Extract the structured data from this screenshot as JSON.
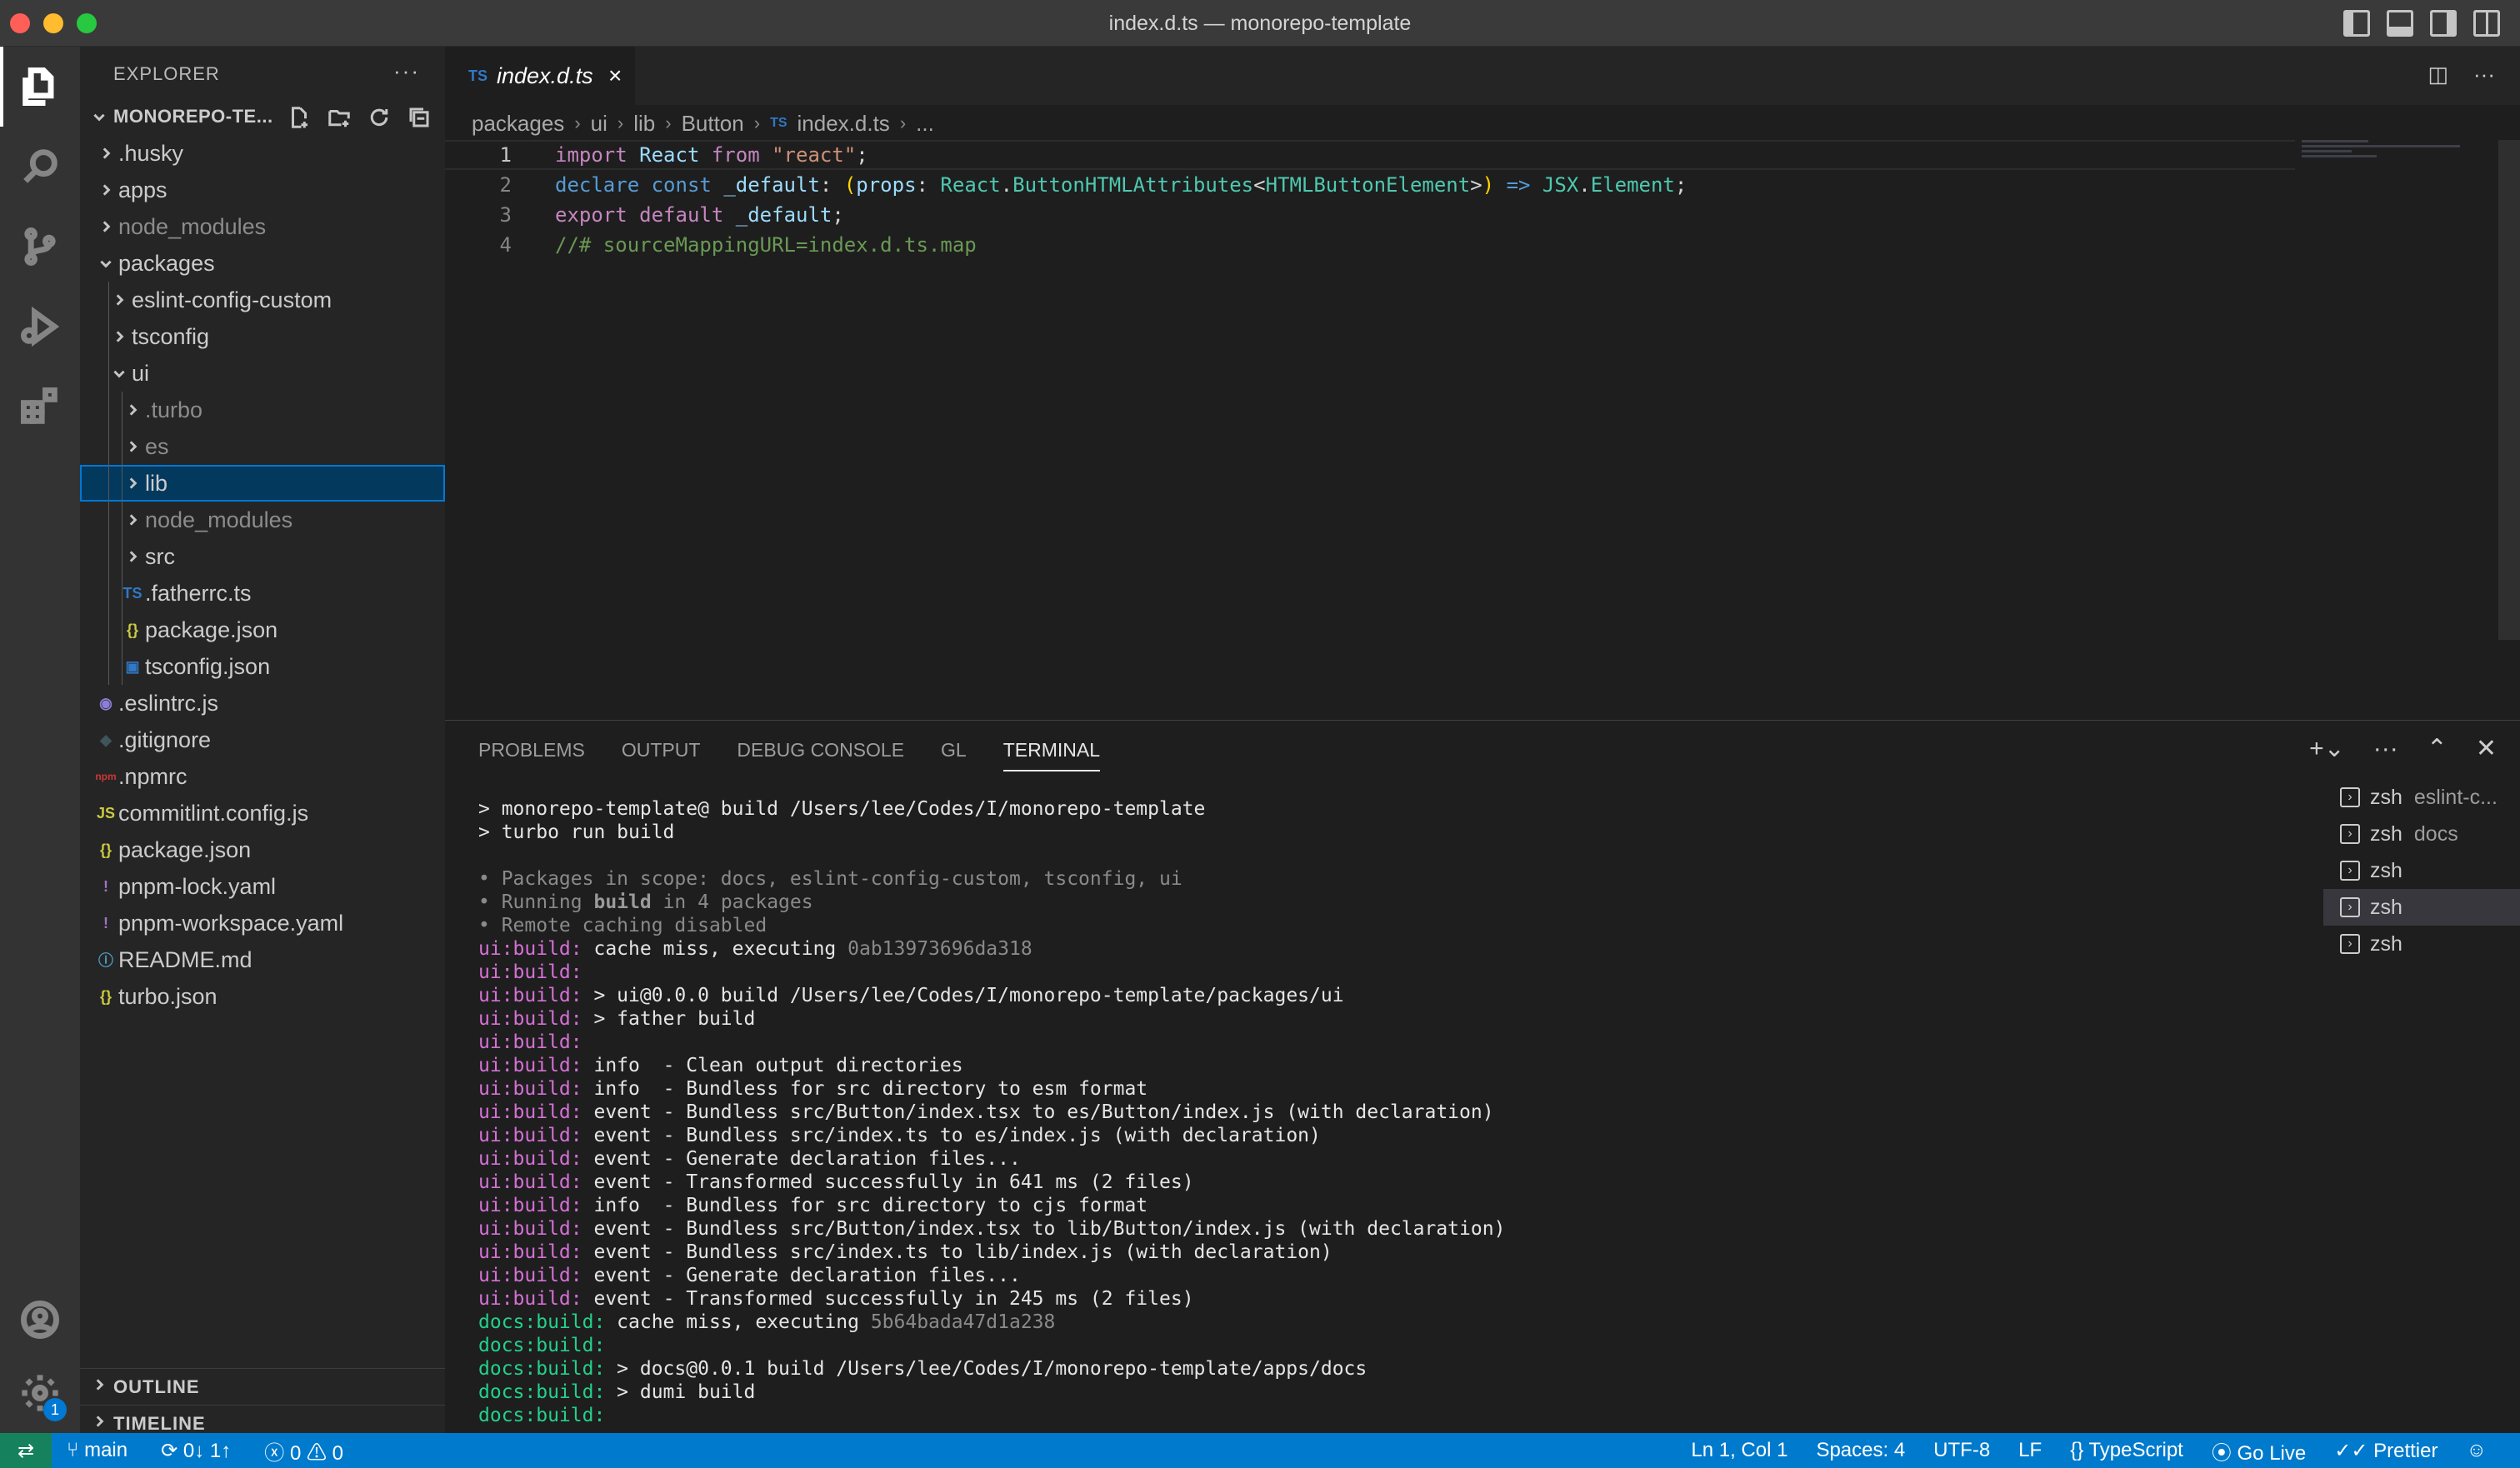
{
  "window": {
    "title": "index.d.ts — monorepo-template"
  },
  "sidebar": {
    "header": "EXPLORER",
    "root_label": "MONOREPO-TE...",
    "tree": [
      {
        "label": ".husky",
        "depth": 0,
        "type": "folder",
        "open": false,
        "dim": false
      },
      {
        "label": "apps",
        "depth": 0,
        "type": "folder",
        "open": false,
        "dim": false
      },
      {
        "label": "node_modules",
        "depth": 0,
        "type": "folder",
        "open": false,
        "dim": true
      },
      {
        "label": "packages",
        "depth": 0,
        "type": "folder",
        "open": true,
        "dim": false
      },
      {
        "label": "eslint-config-custom",
        "depth": 1,
        "type": "folder",
        "open": false,
        "dim": false
      },
      {
        "label": "tsconfig",
        "depth": 1,
        "type": "folder",
        "open": false,
        "dim": false
      },
      {
        "label": "ui",
        "depth": 1,
        "type": "folder",
        "open": true,
        "dim": false
      },
      {
        "label": ".turbo",
        "depth": 2,
        "type": "folder",
        "open": false,
        "dim": true
      },
      {
        "label": "es",
        "depth": 2,
        "type": "folder",
        "open": false,
        "dim": true
      },
      {
        "label": "lib",
        "depth": 2,
        "type": "folder",
        "open": false,
        "dim": false,
        "selected": true
      },
      {
        "label": "node_modules",
        "depth": 2,
        "type": "folder",
        "open": false,
        "dim": true
      },
      {
        "label": "src",
        "depth": 2,
        "type": "folder",
        "open": false,
        "dim": false
      },
      {
        "label": ".fatherrc.ts",
        "depth": 2,
        "type": "file",
        "icon": "ts",
        "dim": false
      },
      {
        "label": "package.json",
        "depth": 2,
        "type": "file",
        "icon": "json",
        "dim": false
      },
      {
        "label": "tsconfig.json",
        "depth": 2,
        "type": "file",
        "icon": "tsconfig",
        "dim": false
      },
      {
        "label": ".eslintrc.js",
        "depth": 0,
        "type": "file",
        "icon": "eslint",
        "dim": false
      },
      {
        "label": ".gitignore",
        "depth": 0,
        "type": "file",
        "icon": "git",
        "dim": false
      },
      {
        "label": ".npmrc",
        "depth": 0,
        "type": "file",
        "icon": "npm",
        "dim": false
      },
      {
        "label": "commitlint.config.js",
        "depth": 0,
        "type": "file",
        "icon": "js",
        "dim": false
      },
      {
        "label": "package.json",
        "depth": 0,
        "type": "file",
        "icon": "json",
        "dim": false
      },
      {
        "label": "pnpm-lock.yaml",
        "depth": 0,
        "type": "file",
        "icon": "yaml",
        "dim": false
      },
      {
        "label": "pnpm-workspace.yaml",
        "depth": 0,
        "type": "file",
        "icon": "yaml",
        "dim": false
      },
      {
        "label": "README.md",
        "depth": 0,
        "type": "file",
        "icon": "info",
        "dim": false
      },
      {
        "label": "turbo.json",
        "depth": 0,
        "type": "file",
        "icon": "json",
        "dim": false
      }
    ],
    "outline_label": "OUTLINE",
    "timeline_label": "TIMELINE"
  },
  "icons": {
    "ts": {
      "glyph": "TS",
      "color": "#3178c6"
    },
    "json": {
      "glyph": "{}",
      "color": "#cbcb41"
    },
    "tsconfig": {
      "glyph": "▣",
      "color": "#3178c6"
    },
    "eslint": {
      "glyph": "◉",
      "color": "#8b7fd8"
    },
    "git": {
      "glyph": "◆",
      "color": "#41535b"
    },
    "npm": {
      "glyph": "npm",
      "color": "#cb3837"
    },
    "js": {
      "glyph": "JS",
      "color": "#cbcb41"
    },
    "yaml": {
      "glyph": "!",
      "color": "#a074c4"
    },
    "info": {
      "glyph": "ⓘ",
      "color": "#519aba"
    }
  },
  "editor": {
    "tab": {
      "badge": "TS",
      "name": "index.d.ts",
      "close": "×"
    },
    "breadcrumbs": [
      "packages",
      "ui",
      "lib",
      "Button",
      "index.d.ts",
      "..."
    ],
    "lines": [
      {
        "n": "1",
        "tokens": [
          [
            "kw2",
            "import"
          ],
          [
            "pu",
            " "
          ],
          [
            "va",
            "React"
          ],
          [
            "pu",
            " "
          ],
          [
            "kw2",
            "from"
          ],
          [
            "pu",
            " "
          ],
          [
            "st",
            "\"react\""
          ],
          [
            "pu",
            ";"
          ]
        ]
      },
      {
        "n": "2",
        "tokens": [
          [
            "kw",
            "declare"
          ],
          [
            "pu",
            " "
          ],
          [
            "kw",
            "const"
          ],
          [
            "pu",
            " "
          ],
          [
            "va",
            "_default"
          ],
          [
            "pu",
            ": "
          ],
          [
            "br",
            "("
          ],
          [
            "va",
            "props"
          ],
          [
            "pu",
            ": "
          ],
          [
            "ty",
            "React"
          ],
          [
            "pu",
            "."
          ],
          [
            "ty",
            "ButtonHTMLAttributes"
          ],
          [
            "pu",
            "<"
          ],
          [
            "ty",
            "HTMLButtonElement"
          ],
          [
            "pu",
            ">"
          ],
          [
            "br",
            ")"
          ],
          [
            "pu",
            " "
          ],
          [
            "kw",
            "=>"
          ],
          [
            "pu",
            " "
          ],
          [
            "ty",
            "JSX"
          ],
          [
            "pu",
            "."
          ],
          [
            "ty",
            "Element"
          ],
          [
            "pu",
            ";"
          ]
        ]
      },
      {
        "n": "3",
        "tokens": [
          [
            "kw2",
            "export"
          ],
          [
            "pu",
            " "
          ],
          [
            "kw2",
            "default"
          ],
          [
            "pu",
            " "
          ],
          [
            "va",
            "_default"
          ],
          [
            "pu",
            ";"
          ]
        ]
      },
      {
        "n": "4",
        "tokens": [
          [
            "cm",
            "//# sourceMappingURL=index.d.ts.map"
          ]
        ]
      }
    ]
  },
  "panel": {
    "tabs": [
      "PROBLEMS",
      "OUTPUT",
      "DEBUG CONSOLE",
      "GL",
      "TERMINAL"
    ],
    "active_tab": "TERMINAL",
    "terminal_lines": [
      [
        [
          "",
          "> monorepo-template@ build /Users/lee/Codes/I/monorepo-template"
        ]
      ],
      [
        [
          "",
          "> turbo run build"
        ]
      ],
      [
        [
          "",
          ""
        ]
      ],
      [
        [
          "gr",
          "• Packages in scope: docs, eslint-config-custom, tsconfig, ui"
        ]
      ],
      [
        [
          "gr",
          "• Running "
        ],
        [
          "bd",
          "build"
        ],
        [
          "gr",
          " in 4 packages"
        ]
      ],
      [
        [
          "gr",
          "• Remote caching disabled"
        ]
      ],
      [
        [
          "mg",
          "ui:build: "
        ],
        [
          "",
          "cache miss, executing "
        ],
        [
          "gr",
          "0ab13973696da318"
        ]
      ],
      [
        [
          "mg",
          "ui:build: "
        ]
      ],
      [
        [
          "mg",
          "ui:build: "
        ],
        [
          "",
          "> ui@0.0.0 build /Users/lee/Codes/I/monorepo-template/packages/ui"
        ]
      ],
      [
        [
          "mg",
          "ui:build: "
        ],
        [
          "",
          "> father build"
        ]
      ],
      [
        [
          "mg",
          "ui:build: "
        ]
      ],
      [
        [
          "mg",
          "ui:build: "
        ],
        [
          "",
          "info  - Clean output directories"
        ]
      ],
      [
        [
          "mg",
          "ui:build: "
        ],
        [
          "",
          "info  - Bundless for src directory to esm format"
        ]
      ],
      [
        [
          "mg",
          "ui:build: "
        ],
        [
          "",
          "event - Bundless src/Button/index.tsx to es/Button/index.js (with declaration)"
        ]
      ],
      [
        [
          "mg",
          "ui:build: "
        ],
        [
          "",
          "event - Bundless src/index.ts to es/index.js (with declaration)"
        ]
      ],
      [
        [
          "mg",
          "ui:build: "
        ],
        [
          "",
          "event - Generate declaration files..."
        ]
      ],
      [
        [
          "mg",
          "ui:build: "
        ],
        [
          "",
          "event - Transformed successfully in 641 ms (2 files)"
        ]
      ],
      [
        [
          "mg",
          "ui:build: "
        ],
        [
          "",
          "info  - Bundless for src directory to cjs format"
        ]
      ],
      [
        [
          "mg",
          "ui:build: "
        ],
        [
          "",
          "event - Bundless src/Button/index.tsx to lib/Button/index.js (with declaration)"
        ]
      ],
      [
        [
          "mg",
          "ui:build: "
        ],
        [
          "",
          "event - Bundless src/index.ts to lib/index.js (with declaration)"
        ]
      ],
      [
        [
          "mg",
          "ui:build: "
        ],
        [
          "",
          "event - Generate declaration files..."
        ]
      ],
      [
        [
          "mg",
          "ui:build: "
        ],
        [
          "",
          "event - Transformed successfully in 245 ms (2 files)"
        ]
      ],
      [
        [
          "gn",
          "docs:build: "
        ],
        [
          "",
          "cache miss, executing "
        ],
        [
          "gr",
          "5b64bada47d1a238"
        ]
      ],
      [
        [
          "gn",
          "docs:build: "
        ]
      ],
      [
        [
          "gn",
          "docs:build: "
        ],
        [
          "",
          "> docs@0.0.1 build /Users/lee/Codes/I/monorepo-template/apps/docs"
        ]
      ],
      [
        [
          "gn",
          "docs:build: "
        ],
        [
          "",
          "> dumi build"
        ]
      ],
      [
        [
          "gn",
          "docs:build: "
        ]
      ]
    ],
    "terminals": [
      {
        "name": "zsh",
        "sub": "eslint-c..."
      },
      {
        "name": "zsh",
        "sub": "docs"
      },
      {
        "name": "zsh",
        "sub": ""
      },
      {
        "name": "zsh",
        "sub": "",
        "selected": true
      },
      {
        "name": "zsh",
        "sub": ""
      }
    ]
  },
  "status": {
    "branch": "main",
    "sync": "0↓ 1↑",
    "errors": "0",
    "warnings": "0",
    "position": "Ln 1, Col 1",
    "spaces": "Spaces: 4",
    "encoding": "UTF-8",
    "eol": "LF",
    "language": "TypeScript",
    "golive": "Go Live",
    "prettier": "Prettier"
  },
  "activity_badge": "1",
  "colors": {
    "statusbar": "#007acc",
    "remote": "#16825d",
    "selection": "#04395e",
    "accent": "#0078d4"
  }
}
